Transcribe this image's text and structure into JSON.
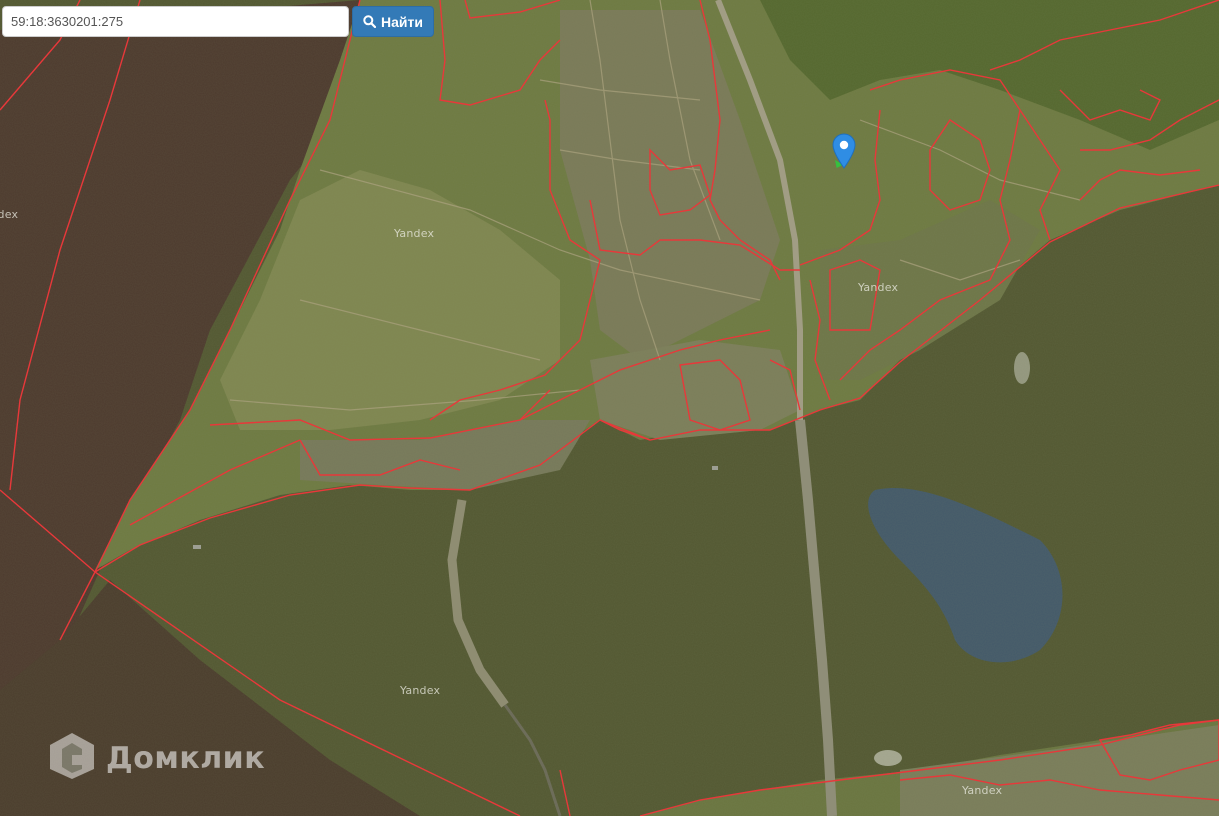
{
  "search": {
    "value": "59:18:3630201:275",
    "button_label": "Найти",
    "button_icon": "search-icon"
  },
  "map": {
    "watermarks": [
      "Yandex",
      "Yandex",
      "Yandex",
      "Yandex",
      "Yandex"
    ],
    "marker_icon": "map-pin-icon",
    "marker_color": "#2f8de4",
    "boundary_color": "#e8383a",
    "water_color": "#4f5431",
    "land_color": "#6b7a3f",
    "pond_color": "#3e5770"
  },
  "brand": {
    "name": "Домклик",
    "icon": "domclick-logo-icon"
  }
}
